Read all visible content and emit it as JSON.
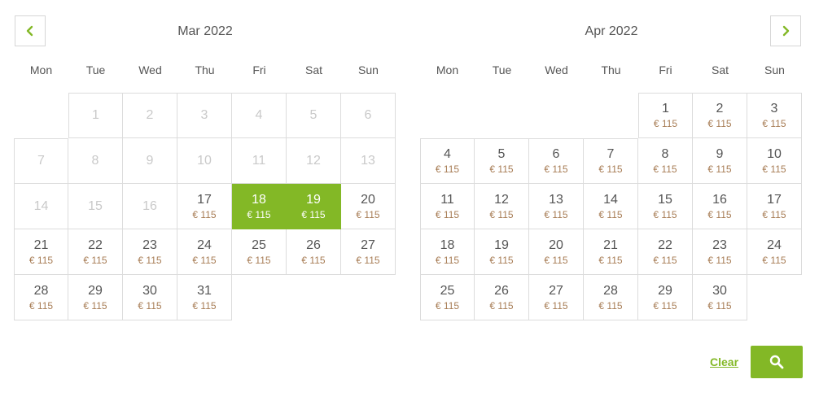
{
  "nav": {
    "prev_icon": "chevron-left-icon",
    "next_icon": "chevron-right-icon"
  },
  "colors": {
    "accent": "#83b826",
    "price": "#a77c54",
    "disabled": "#c9c9c9"
  },
  "weekdays": [
    "Mon",
    "Tue",
    "Wed",
    "Thu",
    "Fri",
    "Sat",
    "Sun"
  ],
  "months": [
    {
      "title": "Mar 2022",
      "lead_blanks": 1,
      "days": [
        {
          "d": "1",
          "state": "disabled"
        },
        {
          "d": "2",
          "state": "disabled"
        },
        {
          "d": "3",
          "state": "disabled"
        },
        {
          "d": "4",
          "state": "disabled"
        },
        {
          "d": "5",
          "state": "disabled"
        },
        {
          "d": "6",
          "state": "disabled"
        },
        {
          "d": "7",
          "state": "disabled"
        },
        {
          "d": "8",
          "state": "disabled"
        },
        {
          "d": "9",
          "state": "disabled"
        },
        {
          "d": "10",
          "state": "disabled"
        },
        {
          "d": "11",
          "state": "disabled"
        },
        {
          "d": "12",
          "state": "disabled"
        },
        {
          "d": "13",
          "state": "disabled"
        },
        {
          "d": "14",
          "state": "disabled"
        },
        {
          "d": "15",
          "state": "disabled"
        },
        {
          "d": "16",
          "state": "disabled"
        },
        {
          "d": "17",
          "price": "€ 115"
        },
        {
          "d": "18",
          "price": "€ 115",
          "state": "selected"
        },
        {
          "d": "19",
          "price": "€ 115",
          "state": "selected"
        },
        {
          "d": "20",
          "price": "€ 115"
        },
        {
          "d": "21",
          "price": "€ 115"
        },
        {
          "d": "22",
          "price": "€ 115"
        },
        {
          "d": "23",
          "price": "€ 115"
        },
        {
          "d": "24",
          "price": "€ 115"
        },
        {
          "d": "25",
          "price": "€ 115"
        },
        {
          "d": "26",
          "price": "€ 115"
        },
        {
          "d": "27",
          "price": "€ 115"
        },
        {
          "d": "28",
          "price": "€ 115"
        },
        {
          "d": "29",
          "price": "€ 115"
        },
        {
          "d": "30",
          "price": "€ 115"
        },
        {
          "d": "31",
          "price": "€ 115"
        }
      ]
    },
    {
      "title": "Apr 2022",
      "lead_blanks": 4,
      "days": [
        {
          "d": "1",
          "price": "€ 115"
        },
        {
          "d": "2",
          "price": "€ 115"
        },
        {
          "d": "3",
          "price": "€ 115"
        },
        {
          "d": "4",
          "price": "€ 115"
        },
        {
          "d": "5",
          "price": "€ 115"
        },
        {
          "d": "6",
          "price": "€ 115"
        },
        {
          "d": "7",
          "price": "€ 115"
        },
        {
          "d": "8",
          "price": "€ 115"
        },
        {
          "d": "9",
          "price": "€ 115"
        },
        {
          "d": "10",
          "price": "€ 115"
        },
        {
          "d": "11",
          "price": "€ 115"
        },
        {
          "d": "12",
          "price": "€ 115"
        },
        {
          "d": "13",
          "price": "€ 115"
        },
        {
          "d": "14",
          "price": "€ 115"
        },
        {
          "d": "15",
          "price": "€ 115"
        },
        {
          "d": "16",
          "price": "€ 115"
        },
        {
          "d": "17",
          "price": "€ 115"
        },
        {
          "d": "18",
          "price": "€ 115"
        },
        {
          "d": "19",
          "price": "€ 115"
        },
        {
          "d": "20",
          "price": "€ 115"
        },
        {
          "d": "21",
          "price": "€ 115"
        },
        {
          "d": "22",
          "price": "€ 115"
        },
        {
          "d": "23",
          "price": "€ 115"
        },
        {
          "d": "24",
          "price": "€ 115"
        },
        {
          "d": "25",
          "price": "€ 115"
        },
        {
          "d": "26",
          "price": "€ 115"
        },
        {
          "d": "27",
          "price": "€ 115"
        },
        {
          "d": "28",
          "price": "€ 115"
        },
        {
          "d": "29",
          "price": "€ 115"
        },
        {
          "d": "30",
          "price": "€ 115"
        }
      ]
    }
  ],
  "actions": {
    "clear_label": "Clear",
    "search_icon": "search-icon"
  }
}
